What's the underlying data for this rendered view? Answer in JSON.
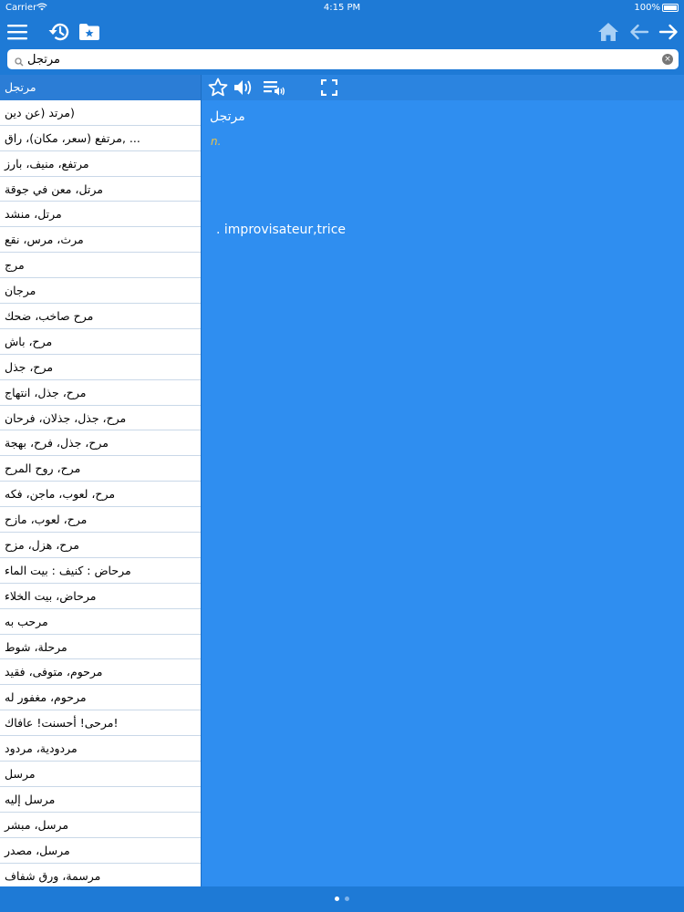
{
  "status_bar": {
    "carrier": "Carrier",
    "time": "4:15 PM",
    "battery": "100%"
  },
  "toolbar": {
    "menu_icon": "hamburger-icon",
    "history_icon": "history-icon",
    "favorites_icon": "star-folder-icon",
    "home_icon": "home-icon",
    "back_icon": "arrow-left-icon",
    "forward_icon": "arrow-right-icon"
  },
  "search": {
    "value": "مرتجل",
    "placeholder": ""
  },
  "word_list": [
    "مرتجل",
    "(مرتد (عن دين",
    "... ,مرتفع (سعر، مكان)، راق",
    "مرتفع، منيف، بارز",
    "مرتل، معن في جوقة",
    "مرتل، منشد",
    "مرث، مرس، نقع",
    "مرج",
    "مرجان",
    "مرح  صاخب، ضحك",
    "مرح، باش",
    "مرح، جذل",
    "مرح، جذل، انتهاج",
    "مرح، جذل، جذلان، فرحان",
    "مرح، جذل، فرح، بهجة",
    "مرح، روح المرح",
    "مرح، لعوب، ماجن، فكه",
    "مرح، لعوب، مازح",
    "مرح، هزل، مزح",
    "مرحاض : كنيف : بيت الماء",
    "مرحاض، بيت الخلاء",
    "مرحب به",
    "مرحلة، شوط",
    "مرحوم، متوفى، فقيد",
    "مرحوم، مغفور له",
    "!مرحى! أحسنت! عافاك",
    "مردودية، مردود",
    "مرسل",
    "مرسل إليه",
    "مرسل، مبشر",
    "مرسل، مصدر",
    "مرسمة، ورق شفاف"
  ],
  "detail": {
    "headword": "مرتجل",
    "part_of_speech": "n.",
    "translation": ". improvisateur,trice",
    "toolbar_icons": [
      "star-icon",
      "speaker-icon",
      "playlist-audio-icon",
      "fullscreen-icon"
    ]
  },
  "page_indicator": {
    "count": 2,
    "active": 0
  },
  "colors": {
    "accent": "#1e7ad6",
    "pane": "#2f8ef0",
    "pos": "#e8c34a"
  }
}
